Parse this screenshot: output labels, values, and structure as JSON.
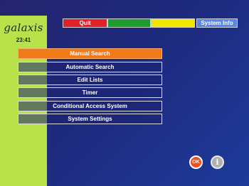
{
  "brand": {
    "logo": "galaxis",
    "time": "23:41"
  },
  "topbar": {
    "quit_label": "Quit",
    "green_label": "",
    "yellow_label": "",
    "system_info_label": "System Info",
    "colors": {
      "red": "#e0202a",
      "green": "#1f9a2e",
      "yellow": "#f0e600",
      "blue": "#5a86e6"
    }
  },
  "menu": {
    "items": [
      {
        "label": "Manual Search",
        "active": true
      },
      {
        "label": "Automatic Search",
        "active": false
      },
      {
        "label": "Edit Lists",
        "active": false
      },
      {
        "label": "Timer",
        "active": false
      },
      {
        "label": "Conditional Access System",
        "active": false
      },
      {
        "label": "System Settings",
        "active": false
      }
    ]
  },
  "buttons": {
    "ok_label": "OK",
    "info_label": "i"
  }
}
